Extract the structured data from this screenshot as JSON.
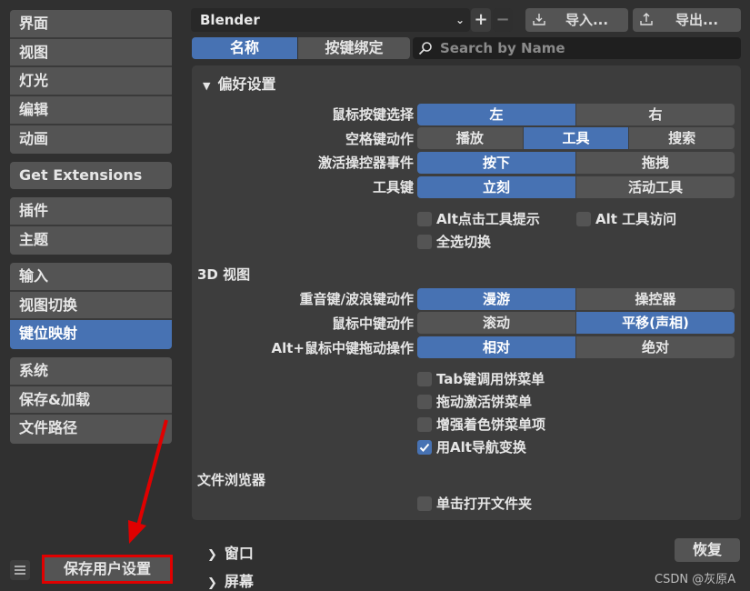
{
  "sidebar": {
    "groups": [
      [
        "界面",
        "视图",
        "灯光",
        "编辑",
        "动画"
      ],
      [
        "Get Extensions"
      ],
      [
        "插件",
        "主题"
      ],
      [
        "输入",
        "视图切换",
        "键位映射"
      ],
      [
        "系统",
        "保存&加载",
        "文件路径"
      ]
    ],
    "active": "键位映射"
  },
  "header": {
    "preset": "Blender",
    "plus": "+",
    "minus": "−",
    "import_label": "导入...",
    "export_label": "导出..."
  },
  "tabs": {
    "name": "名称",
    "binding": "按键绑定",
    "search_placeholder": "Search by Name"
  },
  "prefs": {
    "title": "偏好设置",
    "rows": [
      {
        "label": "鼠标按键选择",
        "options": [
          "左",
          "右"
        ],
        "selected": 0
      },
      {
        "label": "空格键动作",
        "options": [
          "播放",
          "工具",
          "搜索"
        ],
        "selected": 1
      },
      {
        "label": "激活操控器事件",
        "options": [
          "按下",
          "拖拽"
        ],
        "selected": 0
      },
      {
        "label": "工具键",
        "options": [
          "立刻",
          "活动工具"
        ],
        "selected": 0
      }
    ],
    "checks": [
      {
        "label": "Alt点击工具提示",
        "checked": false
      },
      {
        "label": "Alt 工具访问",
        "checked": false
      },
      {
        "label": "全选切换",
        "checked": false
      }
    ]
  },
  "view3d": {
    "title": "3D 视图",
    "rows": [
      {
        "label": "重音键/波浪键动作",
        "options": [
          "漫游",
          "操控器"
        ],
        "selected": 0
      },
      {
        "label": "鼠标中键动作",
        "options": [
          "滚动",
          "平移(声相)"
        ],
        "selected": 1
      },
      {
        "label": "Alt+鼠标中键拖动操作",
        "options": [
          "相对",
          "绝对"
        ],
        "selected": 0
      }
    ],
    "checks": [
      {
        "label": "Tab键调用饼菜单",
        "checked": false
      },
      {
        "label": "拖动激活饼菜单",
        "checked": false
      },
      {
        "label": "增强着色饼菜单项",
        "checked": false
      },
      {
        "label": "用Alt导航变换",
        "checked": true
      }
    ]
  },
  "file_browser": {
    "title": "文件浏览器",
    "checks": [
      {
        "label": "单击打开文件夹",
        "checked": false
      }
    ]
  },
  "bottom": {
    "window": "窗口",
    "screen": "屏幕",
    "restore": "恢复",
    "save_prefs": "保存用户设置",
    "watermark": "CSDN @灰原A"
  },
  "colors": {
    "accent": "#4772b3",
    "annotation": "#e00000"
  }
}
